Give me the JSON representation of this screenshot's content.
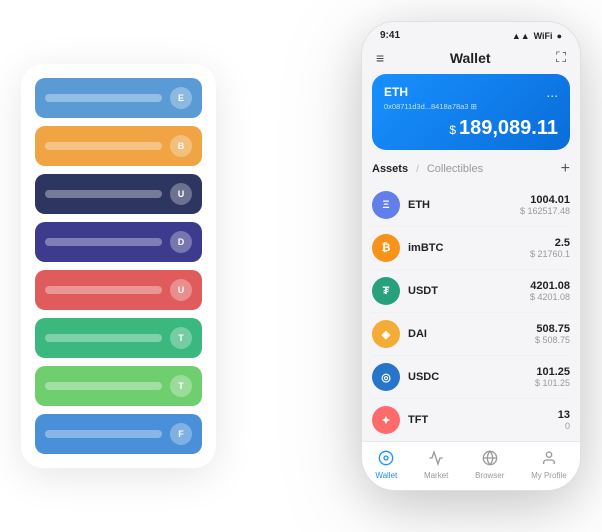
{
  "scene": {
    "background": "#ffffff"
  },
  "cardStack": {
    "cards": [
      {
        "color": "#5b9bd5",
        "label": "",
        "iconText": "E"
      },
      {
        "color": "#f0a443",
        "label": "",
        "iconText": "B"
      },
      {
        "color": "#2d3561",
        "label": "",
        "iconText": "U"
      },
      {
        "color": "#3d3b8e",
        "label": "",
        "iconText": "D"
      },
      {
        "color": "#e05c5c",
        "label": "",
        "iconText": "U"
      },
      {
        "color": "#3bb87e",
        "label": "",
        "iconText": "T"
      },
      {
        "color": "#6fcf6f",
        "label": "",
        "iconText": "T"
      },
      {
        "color": "#4a90d9",
        "label": "",
        "iconText": "F"
      }
    ]
  },
  "phone": {
    "statusBar": {
      "time": "9:41",
      "icons": "▲ ◆ ●"
    },
    "header": {
      "menuIcon": "≡",
      "title": "Wallet",
      "expandIcon": "⛶"
    },
    "ethCard": {
      "ticker": "ETH",
      "address": "0x08711d3d...8418a78a3",
      "addressSuffix": "⊞",
      "dotsMenu": "...",
      "currencySymbol": "$",
      "amount": "189,089.11"
    },
    "assets": {
      "tabActive": "Assets",
      "divider": "/",
      "tabInactive": "Collectibles",
      "addIcon": "+"
    },
    "assetList": [
      {
        "name": "ETH",
        "iconBg": "#627eea",
        "iconText": "Ξ",
        "amount": "1004.01",
        "usd": "$ 162517.48",
        "iconClass": "icon-eth"
      },
      {
        "name": "imBTC",
        "iconBg": "#f7931a",
        "iconText": "₿",
        "amount": "2.5",
        "usd": "$ 21760.1",
        "iconClass": "icon-imbtc"
      },
      {
        "name": "USDT",
        "iconBg": "#26a17b",
        "iconText": "₮",
        "amount": "4201.08",
        "usd": "$ 4201.08",
        "iconClass": "icon-usdt"
      },
      {
        "name": "DAI",
        "iconBg": "#f5ac37",
        "iconText": "◈",
        "amount": "508.75",
        "usd": "$ 508.75",
        "iconClass": "icon-dai"
      },
      {
        "name": "USDC",
        "iconBg": "#2775ca",
        "iconText": "◎",
        "amount": "101.25",
        "usd": "$ 101.25",
        "iconClass": "icon-usdc"
      },
      {
        "name": "TFT",
        "iconBg": "#ff6b6b",
        "iconText": "✦",
        "amount": "13",
        "usd": "0",
        "iconClass": "icon-tft"
      }
    ],
    "bottomNav": [
      {
        "icon": "◎",
        "label": "Wallet",
        "active": true
      },
      {
        "icon": "📈",
        "label": "Market",
        "active": false
      },
      {
        "icon": "🌐",
        "label": "Browser",
        "active": false
      },
      {
        "icon": "👤",
        "label": "My Profile",
        "active": false
      }
    ]
  }
}
